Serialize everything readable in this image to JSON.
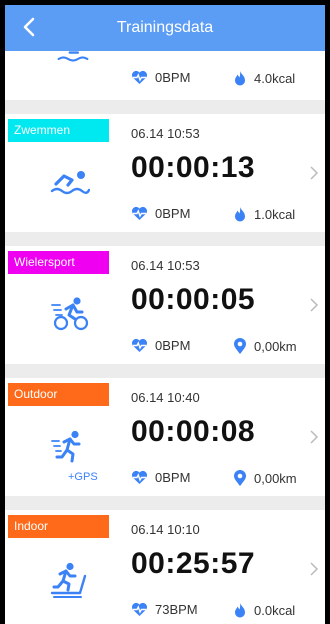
{
  "header": {
    "title": "Trainingsdata"
  },
  "colors": {
    "header": "#5b9cf5",
    "icon_blue": "#3b82f6",
    "zwemmen": "#00e8f0",
    "wielersport": "#f000f0",
    "outdoor": "#ff6a1a",
    "indoor": "#ff6a1a"
  },
  "cards": [
    {
      "tag": "",
      "date": "",
      "duration": "",
      "heart": "0BPM",
      "metric": "4.0kcal",
      "metric_icon": "flame-icon",
      "sport_icon": "swimming-icon"
    },
    {
      "tag": "Zwemmen",
      "date": "06.14 10:53",
      "duration": "00:00:13",
      "heart": "0BPM",
      "metric": "1.0kcal",
      "metric_icon": "flame-icon",
      "sport_icon": "swimming-icon"
    },
    {
      "tag": "Wielersport",
      "date": "06.14 10:53",
      "duration": "00:00:05",
      "heart": "0BPM",
      "metric": "0,00km",
      "metric_icon": "location-pin-icon",
      "sport_icon": "cycling-icon"
    },
    {
      "tag": "Outdoor",
      "date": "06.14 10:40",
      "duration": "00:00:08",
      "heart": "0BPM",
      "metric": "0,00km",
      "metric_icon": "location-pin-icon",
      "sport_icon": "running-icon",
      "gps": "+GPS"
    },
    {
      "tag": "Indoor",
      "date": "06.14 10:10",
      "duration": "00:25:57",
      "heart": "73BPM",
      "metric": "0.0kcal",
      "metric_icon": "flame-icon",
      "sport_icon": "treadmill-icon"
    }
  ]
}
